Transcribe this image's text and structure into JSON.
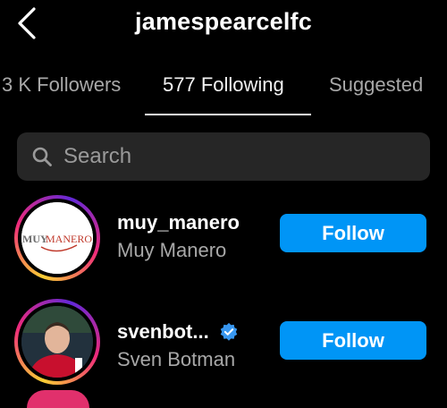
{
  "header": {
    "title": "jamespearcelfc",
    "back_icon": "chevron-left-icon"
  },
  "tabs": [
    {
      "label": "3 K Followers",
      "active": false
    },
    {
      "label": "577 Following",
      "active": true
    },
    {
      "label": "Suggested",
      "active": false
    }
  ],
  "search": {
    "placeholder": "Search",
    "icon": "search-icon"
  },
  "accounts": [
    {
      "username": "muy_manero",
      "full_name": "Muy Manero",
      "verified": false,
      "avatar_logo_text": "MUYMANERO",
      "button_label": "Follow"
    },
    {
      "username": "svenbot...",
      "full_name": "Sven Botman",
      "verified": true,
      "button_label": "Follow"
    }
  ],
  "colors": {
    "background": "#000000",
    "follow_button": "#0095f6",
    "verified_badge": "#3897f0",
    "secondary_text": "#a8a8a8",
    "search_bg": "#262626"
  }
}
